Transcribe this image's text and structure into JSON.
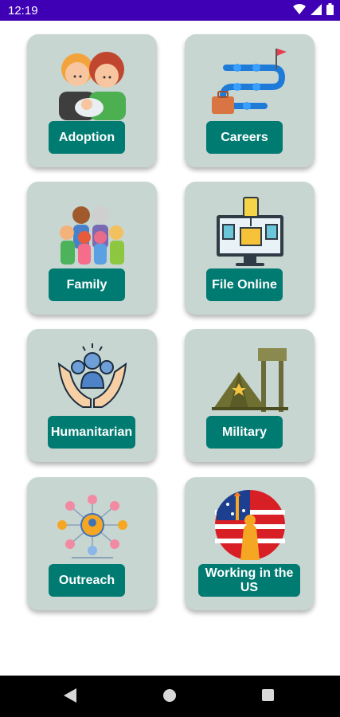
{
  "status_bar": {
    "time": "12:19"
  },
  "tiles": [
    {
      "label": "Adoption",
      "icon": "family-with-baby-icon"
    },
    {
      "label": "Careers",
      "icon": "career-path-icon"
    },
    {
      "label": "Family",
      "icon": "family-group-icon"
    },
    {
      "label": "File Online",
      "icon": "computer-documents-icon"
    },
    {
      "label": "Humanitarian",
      "icon": "hands-holding-people-icon"
    },
    {
      "label": "Military",
      "icon": "military-tent-icon"
    },
    {
      "label": "Outreach",
      "icon": "network-people-icon"
    },
    {
      "label": "Working in the US",
      "icon": "statue-of-liberty-flag-icon"
    }
  ],
  "colors": {
    "status_bar": "#3f00b5",
    "card_bg": "#c8d6d2",
    "button_bg": "#007b71",
    "nav_bar": "#000000"
  }
}
